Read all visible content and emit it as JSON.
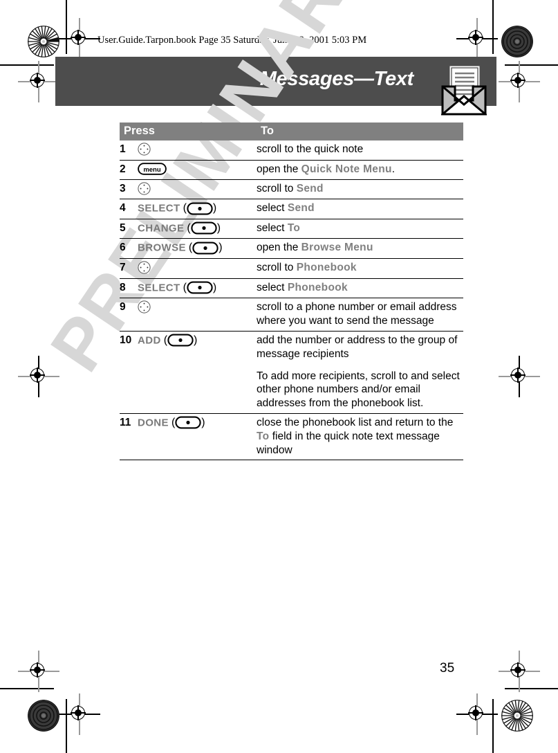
{
  "document": {
    "file_line": "User.Guide.Tarpon.book  Page 35  Saturday, June 23, 2001  5:03 PM",
    "chapter_title": "Messages—Text",
    "page_number": "35",
    "watermark": "PRELIMINARY",
    "header_icon": "envelope-message-icon"
  },
  "colors": {
    "header_band": "#4d4d4d",
    "table_header": "#808080",
    "key_label": "#7a7a7a",
    "screen_text": "#808080",
    "watermark": "#d7d7d7"
  },
  "table": {
    "columns": [
      "Press",
      "To"
    ],
    "rows": [
      {
        "num": "1",
        "key_label": "",
        "key_icon": "nav-scroll-key",
        "to_parts": [
          {
            "t": "scroll to the quick note",
            "s": "normal"
          }
        ]
      },
      {
        "num": "2",
        "key_label": "",
        "key_icon": "menu-key",
        "key_icon_text": "menu",
        "to_parts": [
          {
            "t": "open the ",
            "s": "normal"
          },
          {
            "t": "Quick Note Menu",
            "s": "screen"
          },
          {
            "t": ".",
            "s": "normal"
          }
        ]
      },
      {
        "num": "3",
        "key_label": "",
        "key_icon": "nav-scroll-key",
        "to_parts": [
          {
            "t": "scroll to ",
            "s": "normal"
          },
          {
            "t": "Send",
            "s": "screen"
          }
        ]
      },
      {
        "num": "4",
        "key_label": "SELECT",
        "key_icon": "oval-select-key",
        "to_parts": [
          {
            "t": "select ",
            "s": "normal"
          },
          {
            "t": "Send",
            "s": "screen"
          }
        ]
      },
      {
        "num": "5",
        "key_label": "CHANGE",
        "key_icon": "oval-select-key",
        "to_parts": [
          {
            "t": "select ",
            "s": "normal"
          },
          {
            "t": "To",
            "s": "screen"
          }
        ]
      },
      {
        "num": "6",
        "key_label": "BROWSE",
        "key_icon": "oval-select-key",
        "to_parts": [
          {
            "t": "open the ",
            "s": "normal"
          },
          {
            "t": "Browse Menu",
            "s": "screen"
          }
        ]
      },
      {
        "num": "7",
        "key_label": "",
        "key_icon": "nav-scroll-key",
        "to_parts": [
          {
            "t": "scroll to ",
            "s": "normal"
          },
          {
            "t": "Phonebook",
            "s": "screen"
          }
        ]
      },
      {
        "num": "8",
        "key_label": "SELECT",
        "key_icon": "oval-select-key",
        "to_parts": [
          {
            "t": "select ",
            "s": "normal"
          },
          {
            "t": "Phonebook",
            "s": "screen"
          }
        ]
      },
      {
        "num": "9",
        "key_label": "",
        "key_icon": "nav-scroll-key",
        "to_parts": [
          {
            "t": "scroll to a phone number or email address where you want to send the message",
            "s": "normal"
          }
        ]
      },
      {
        "num": "10",
        "key_label": "ADD",
        "key_icon": "oval-select-key",
        "to_parts": [
          {
            "t": "add the number or address to the group of message recipients",
            "s": "normal"
          }
        ],
        "to_paragraph_2": "To add more recipients, scroll to and select other phone numbers and/or email addresses from the phonebook list."
      },
      {
        "num": "11",
        "key_label": "DONE",
        "key_icon": "oval-select-key",
        "to_parts": [
          {
            "t": "close the phonebook list and return to the ",
            "s": "normal"
          },
          {
            "t": "To",
            "s": "screen"
          },
          {
            "t": " field in the quick note text message window",
            "s": "normal"
          }
        ]
      }
    ]
  }
}
